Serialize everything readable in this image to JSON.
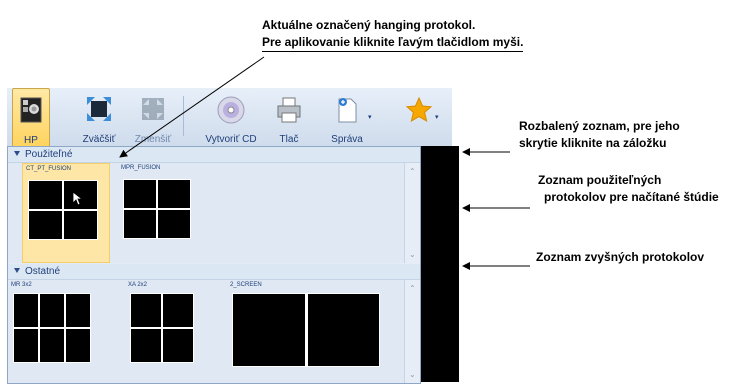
{
  "callouts": {
    "top_line1": "Aktuálne označený hanging protokol.",
    "top_line2": "Pre aplikovanie kliknite ľavým tlačidlom myši.",
    "right1_line1": "Rozbalený zoznam, pre jeho",
    "right1_line2": "skrytie kliknite na záložku",
    "right2_line1": "Zoznam použiteľných",
    "right2_line2": "protokolov pre načítané štúdie",
    "right3": "Zoznam zvyšných protokolov"
  },
  "toolbar": {
    "hp": "HP",
    "zoom_in": "Zväčšiť",
    "zoom_out": "Zmenšiť",
    "burn_cd": "Vytvoriť CD",
    "print": "Tlač",
    "report": "Správa"
  },
  "panel": {
    "usable_header": "Použiteľné",
    "other_header": "Ostatné",
    "usable_items": [
      "CT_PT_FUSION",
      "MPR_FUSION"
    ],
    "other_items": [
      "MR 3x2",
      "XA 2x2",
      "2_SCREEN"
    ]
  },
  "colors": {
    "selected": "#fde6a6",
    "toolbar": "#dce7f4",
    "accent_star": "#f6a800"
  }
}
